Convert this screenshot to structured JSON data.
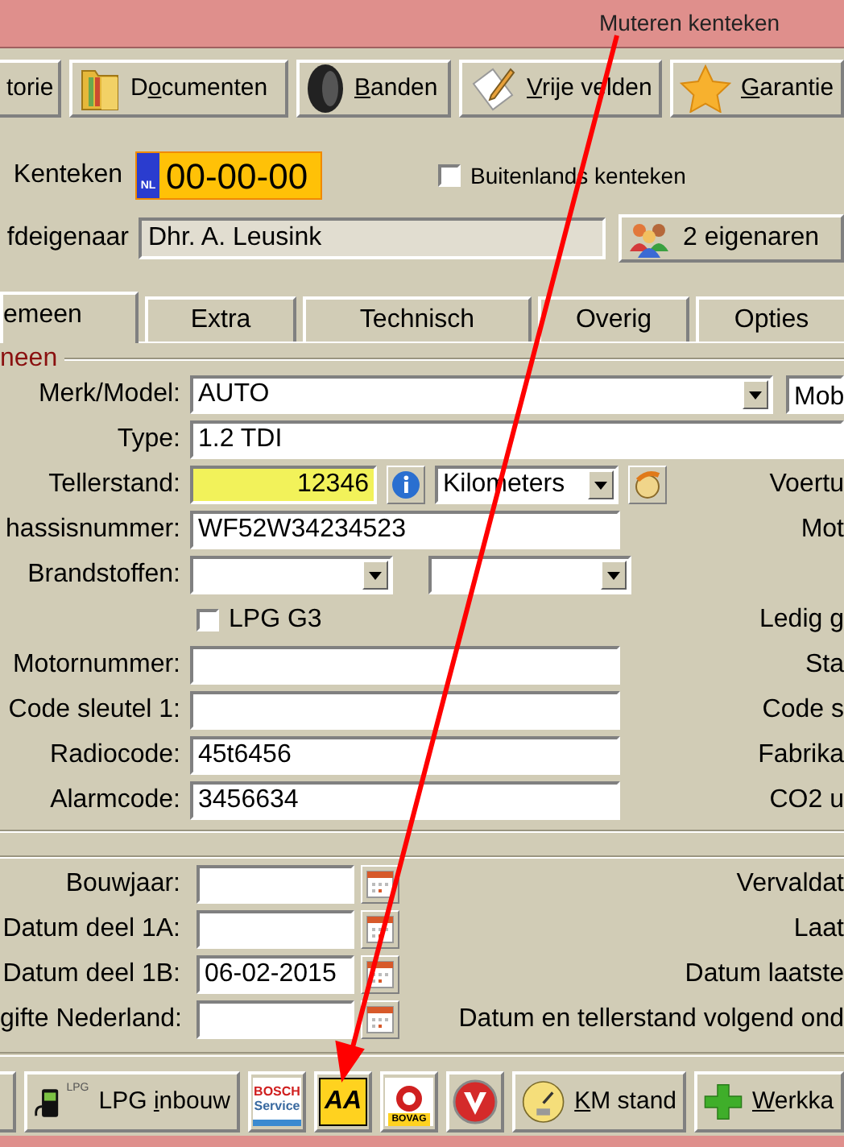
{
  "annotation": {
    "label": "Muteren kenteken"
  },
  "toolbar": [
    {
      "kind": "plain",
      "label": {
        "pre": "torie"
      }
    },
    {
      "kind": "folder",
      "label": {
        "pre": "D",
        "key": "o",
        "post": "cumenten"
      }
    },
    {
      "kind": "tire",
      "label": {
        "key": "B",
        "post": "anden"
      }
    },
    {
      "kind": "note",
      "label": {
        "key": "V",
        "post": "rije velden"
      }
    },
    {
      "kind": "star",
      "label": {
        "key": "G",
        "post": "arantie"
      }
    }
  ],
  "plate": {
    "label": "Kenteken",
    "country": "NL",
    "value": "00-00-00"
  },
  "foreign_plate": {
    "label": "Buitenlands kenteken",
    "checked": false
  },
  "owner": {
    "label": "fdeigenaar",
    "value": "Dhr. A. Leusink",
    "button": "2 eigenaren"
  },
  "tabs": [
    {
      "label": "emeen",
      "selected": true
    },
    {
      "label": "Extra",
      "selected": false
    },
    {
      "label": "Technisch",
      "selected": false
    },
    {
      "label": "Overig",
      "selected": false
    },
    {
      "label": "Opties",
      "selected": false
    }
  ],
  "section": {
    "legend": "neen"
  },
  "fields": [
    {
      "kind": "combo",
      "label": "Merk/Model:",
      "value": "AUTO",
      "extra": "Mob"
    },
    {
      "kind": "wide_text",
      "label": "Type:",
      "value": "1.2 TDI"
    },
    {
      "kind": "counter",
      "label": "Tellerstand:",
      "value": "12346",
      "unit": "Kilometers",
      "right_label": "Voertu"
    },
    {
      "kind": "text",
      "label": "hassisnummer:",
      "value": "WF52W34234523",
      "right_label": "Mot"
    },
    {
      "kind": "pair",
      "label": "Brandstoffen:"
    },
    {
      "kind": "checkbox",
      "label": "LPG G3",
      "checked": false,
      "right_label": "Ledig g"
    },
    {
      "kind": "text",
      "label": "Motornummer:",
      "right_label": "Sta"
    },
    {
      "kind": "text",
      "label": "Code sleutel 1:",
      "right_label": "Code s"
    },
    {
      "kind": "text",
      "label": "Radiocode:",
      "value": "45t6456",
      "right_label": "Fabrika"
    },
    {
      "kind": "text",
      "label": "Alarmcode:",
      "value": "3456634",
      "right_label": "CO2 u"
    }
  ],
  "dates": [
    {
      "label": "Bouwjaar:",
      "right_label": "Vervaldat"
    },
    {
      "label": "Datum deel 1A:",
      "right_label": "Laat"
    },
    {
      "label": "Datum deel 1B:",
      "value": "06-02-2015",
      "right_label": "Datum laatste"
    },
    {
      "label": "gifte Nederland:",
      "right_label": "Datum en tellerstand volgend ond"
    }
  ],
  "bottom_bar": [
    {
      "kind": "partial"
    },
    {
      "kind": "lpg",
      "label": {
        "pre": "LPG ",
        "key": "i",
        "post": "nbouw"
      },
      "logo_text": "LPG"
    },
    {
      "kind": "bosch",
      "logo_text": "BOSCH",
      "logo_subtext": "Service"
    },
    {
      "kind": "aa",
      "logo_text": "AA"
    },
    {
      "kind": "bovag",
      "logo_text": "BOVAG"
    },
    {
      "kind": "v"
    },
    {
      "kind": "gauge",
      "label": {
        "key": "K",
        "post": "M stand"
      }
    },
    {
      "kind": "plus",
      "label": {
        "key": "W",
        "post": "erkka"
      }
    }
  ]
}
